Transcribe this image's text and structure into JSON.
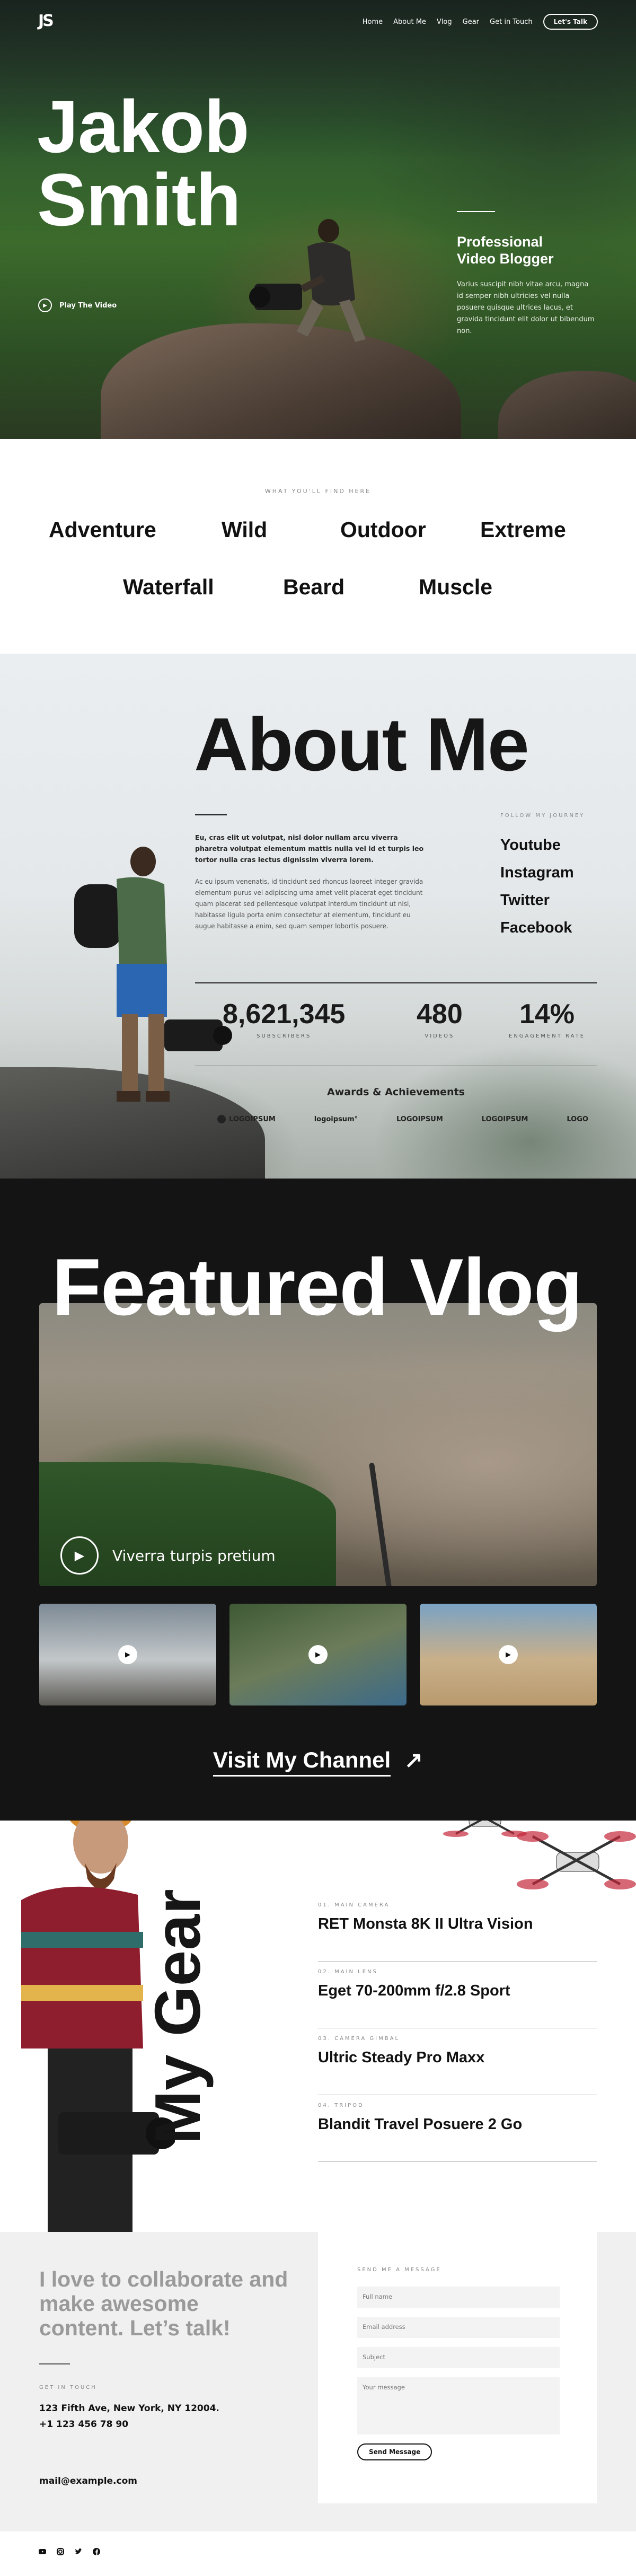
{
  "colors": {
    "accent": "#111111",
    "dark": "#141414",
    "light": "#f0f0f0"
  },
  "hero": {
    "logo": "JS",
    "nav": [
      "Home",
      "About Me",
      "Vlog",
      "Gear",
      "Get in Touch"
    ],
    "cta": "Let's Talk",
    "title_line1": "Jakob",
    "title_line2": "Smith",
    "play_label": "Play The Video",
    "subtitle_line1": "Professional",
    "subtitle_line2": "Video Blogger",
    "description": "Varius suscipit nibh vitae arcu, magna id semper nibh ultricies vel nulla posuere quisque ultrices lacus, et gravida tincidunt elit dolor ut bibendum non."
  },
  "find": {
    "eyebrow": "WHAT YOU'LL FIND HERE",
    "tags": [
      "Adventure",
      "Wild",
      "Outdoor",
      "Extreme",
      "Waterfall",
      "Beard",
      "Muscle"
    ]
  },
  "about": {
    "title": "About Me",
    "lead": "Eu, cras elit ut volutpat, nisl dolor nullam arcu viverra pharetra volutpat elementum mattis nulla vel id et turpis leo tortor nulla cras lectus dignissim viverra lorem.",
    "body": "Ac eu ipsum venenatis, id tincidunt sed rhoncus laoreet integer gravida elementum purus vel adipiscing urna amet velit placerat eget tincidunt quam placerat sed pellentesque volutpat interdum tincidunt ut nisi, habitasse ligula porta enim consectetur at elementum, tincidunt eu augue habitasse a enim, sed quam semper lobortis posuere.",
    "follow_label": "FOLLOW MY JOURNEY",
    "socials": [
      "Youtube",
      "Instagram",
      "Twitter",
      "Facebook"
    ],
    "stats": [
      {
        "value": "8,621,345",
        "label": "SUBSCRIBERS"
      },
      {
        "value": "480",
        "label": "VIDEOS"
      },
      {
        "value": "14%",
        "label": "ENGAGEMENT RATE"
      }
    ],
    "awards_title": "Awards & Achievements",
    "award_logos": [
      "LOGOIPSUM",
      "logoipsum°",
      "LOGOIPSUM",
      "LOGOIPSUM",
      "LOGO"
    ]
  },
  "vlog": {
    "title": "Featured Vlog",
    "featured_caption": "Viverra turpis pretium",
    "visit_label": "Visit My Channel"
  },
  "gear": {
    "title": "My Gear",
    "items": [
      {
        "eyebrow": "01. MAIN CAMERA",
        "name": "RET Monsta 8K II Ultra Vision"
      },
      {
        "eyebrow": "02. MAIN LENS",
        "name": "Eget 70-200mm f/2.8 Sport"
      },
      {
        "eyebrow": "03. CAMERA GIMBAL",
        "name": "Ultric Steady Pro Maxx"
      },
      {
        "eyebrow": "04. TRIPOD",
        "name": "Blandit Travel Posuere 2 Go"
      }
    ]
  },
  "contact": {
    "heading": "I love to collaborate and make awesome content. Let’s talk!",
    "get_in_touch": "GET IN TOUCH",
    "address": "123 Fifth Ave, New York, NY 12004.",
    "phone": "+1 123 456 78 90",
    "email": "mail@example.com",
    "form_title": "SEND ME A MESSAGE",
    "placeholders": {
      "name": "Full name",
      "email": "Email address",
      "subject": "Subject",
      "message": "Your message"
    },
    "send_label": "Send Message"
  },
  "footer": {
    "icons": [
      "youtube-icon",
      "instagram-icon",
      "twitter-icon",
      "facebook-icon"
    ]
  }
}
